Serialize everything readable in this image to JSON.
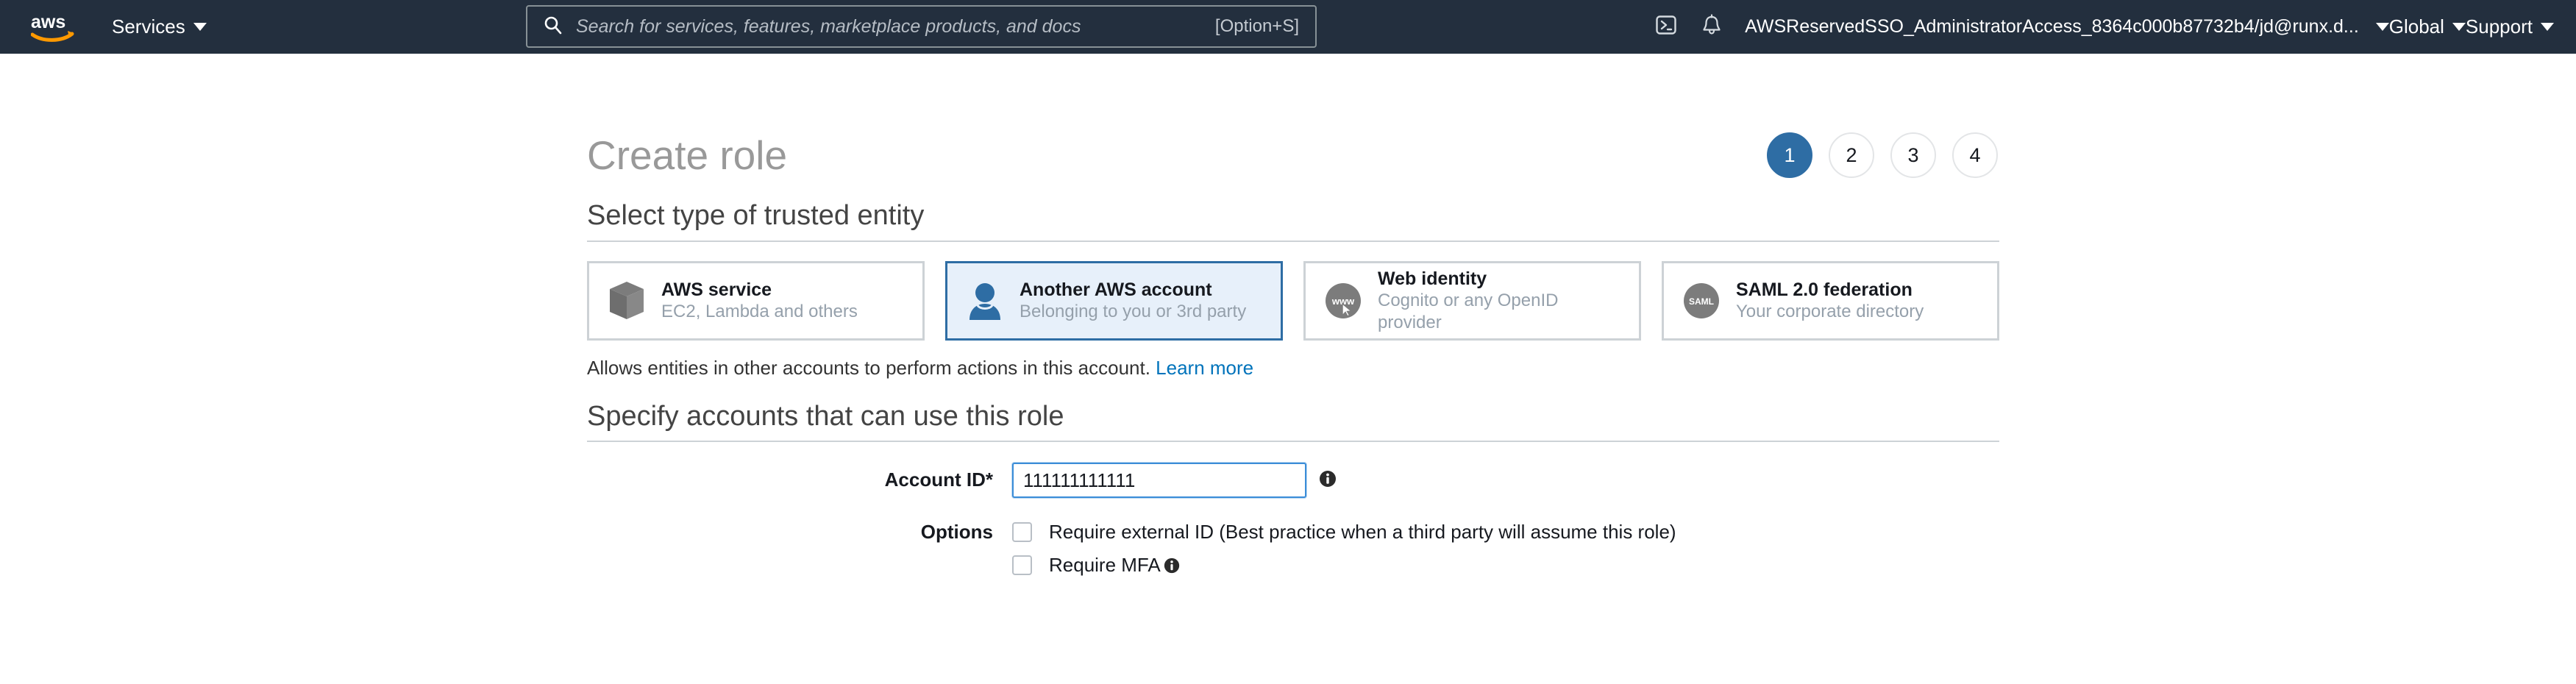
{
  "nav": {
    "logo_alt": "aws",
    "services_label": "Services",
    "search": {
      "placeholder": "Search for services, features, marketplace products, and docs",
      "shortcut": "[Option+S]"
    },
    "account_label": "AWSReservedSSO_AdministratorAccess_8364c000b87732b4/jd@runx.d...",
    "region_label": "Global",
    "support_label": "Support"
  },
  "page": {
    "title": "Create role",
    "steps": [
      {
        "label": "1",
        "active": true
      },
      {
        "label": "2",
        "active": false
      },
      {
        "label": "3",
        "active": false
      },
      {
        "label": "4",
        "active": false
      }
    ]
  },
  "trusted_entity": {
    "heading": "Select type of trusted entity",
    "cards": [
      {
        "icon": "cube-icon",
        "title": "AWS service",
        "subtitle": "EC2, Lambda and others",
        "selected": false
      },
      {
        "icon": "person-icon",
        "title": "Another AWS account",
        "subtitle": "Belonging to you or 3rd party",
        "selected": true
      },
      {
        "icon": "www-cursor-icon",
        "title": "Web identity",
        "subtitle": "Cognito or any OpenID provider",
        "selected": false
      },
      {
        "icon": "saml-icon",
        "title": "SAML 2.0 federation",
        "subtitle": "Your corporate directory",
        "selected": false
      }
    ],
    "description": "Allows entities in other accounts to perform actions in this account.",
    "learn_more": "Learn more"
  },
  "specify_accounts": {
    "heading": "Specify accounts that can use this role",
    "account_id_label": "Account ID*",
    "account_id_value": "111111111111",
    "account_id_placeholder": "",
    "options_label": "Options",
    "options": [
      {
        "label": "Require external ID (Best practice when a third party will assume this role)",
        "checked": false,
        "has_info": false
      },
      {
        "label": "Require MFA",
        "checked": false,
        "has_info": true
      }
    ]
  },
  "colors": {
    "nav_bg": "#232f3e",
    "accent_blue": "#2e6da4",
    "link_blue": "#0073bb",
    "selected_card_bg": "#e7f0fa",
    "aws_orange": "#f90"
  }
}
